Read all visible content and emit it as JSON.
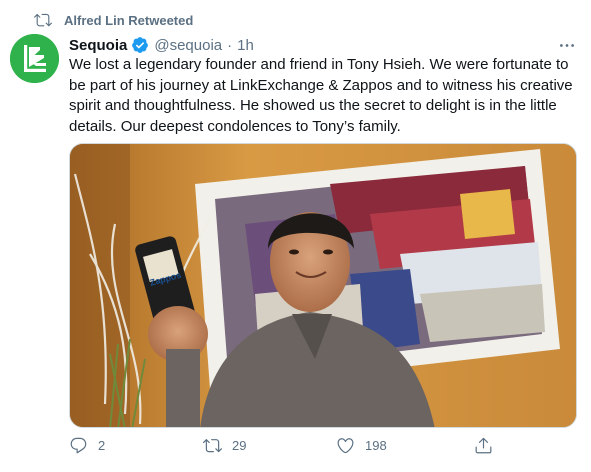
{
  "retweet_banner": {
    "text": "Alfred Lin Retweeted",
    "icon": "retweet-icon"
  },
  "author": {
    "name": "Sequoia",
    "handle": "@sequoia",
    "separator": "·",
    "time": "1h",
    "verified_icon": "verified-badge-icon",
    "avatar_color": "#2fb24c"
  },
  "tweet": {
    "text": "We lost a legendary founder and friend in Tony Hsieh. We were fortunate to be part of his journey at LinkExchange & Zappos and to witness his creative spirit and thoughtfulness. He showed us the secret to delight is in the little details. Our deepest condolences to Tony’s family."
  },
  "media": {
    "phone_label": "Zappos"
  },
  "actions": {
    "reply_count": "2",
    "retweet_count": "29",
    "like_count": "198"
  },
  "colors": {
    "muted": "#5b7083",
    "accent": "#1d9bf0",
    "text": "#0f1419"
  }
}
